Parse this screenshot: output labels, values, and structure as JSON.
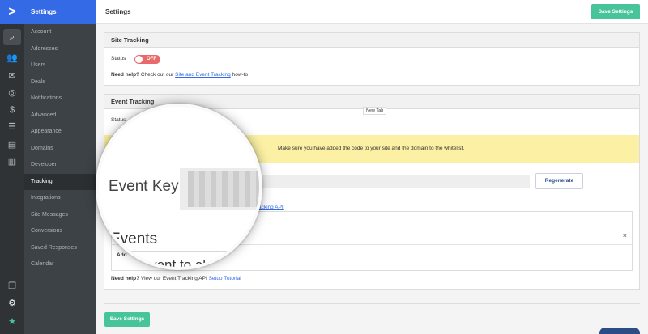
{
  "sidebar": {
    "header": "Settings",
    "items": [
      {
        "label": "Account"
      },
      {
        "label": "Addresses"
      },
      {
        "label": "Users"
      },
      {
        "label": "Deals"
      },
      {
        "label": "Notifications"
      },
      {
        "label": "Advanced"
      },
      {
        "label": "Appearance"
      },
      {
        "label": "Domains"
      },
      {
        "label": "Developer"
      },
      {
        "label": "Tracking",
        "active": true
      },
      {
        "label": "Integrations"
      },
      {
        "label": "Site Messages"
      },
      {
        "label": "Conversions"
      },
      {
        "label": "Saved Responses"
      },
      {
        "label": "Calendar"
      }
    ]
  },
  "rail": {
    "logo": ">",
    "icons": [
      "search-icon",
      "contacts-icon",
      "mail-icon",
      "automation-icon",
      "dollar-icon",
      "list-icon",
      "forms-icon",
      "reports-icon",
      "pages-icon",
      "gear-icon",
      "star-icon"
    ],
    "glyphs": {
      "search": "⌕",
      "contacts": "👥",
      "mail": "✉",
      "automation": "◎",
      "dollar": "$",
      "list": "☰",
      "forms": "▤",
      "reports": "▥",
      "pages": "❐",
      "gear": "⚙",
      "star": "★"
    }
  },
  "header": {
    "title": "Settings",
    "save_label": "Save Settings"
  },
  "site_tracking": {
    "title": "Site Tracking",
    "status_label": "Status",
    "toggle_text": "OFF",
    "help_bold": "Need help?",
    "help_text": " Check out our ",
    "help_link": "Site and Event Tracking",
    "help_suffix": " how-to"
  },
  "event_tracking": {
    "title": "Event Tracking",
    "status_label": "Status",
    "toggle_text": "O",
    "warning": "Make sure you have added the code to your site and the domain to the whitelist.",
    "event_key_label": "Event Key",
    "regenerate_label": "Regenerate",
    "api_link_fragment": "acking API",
    "events_label": "Events",
    "add_label": "Add",
    "add_event_text": "an event to al",
    "close_glyph": "×",
    "help_bold": "Need help?",
    "help_text": " View our Event Tracking API ",
    "help_link": "Setup Tutorial"
  },
  "tooltip": "New Tab",
  "footer": {
    "save_label": "Save Settings"
  },
  "colors": {
    "brand_blue": "#356ae6",
    "green": "#48c49a",
    "toggle_off": "#e96a6a",
    "warning_bg": "#fbf0a3"
  }
}
